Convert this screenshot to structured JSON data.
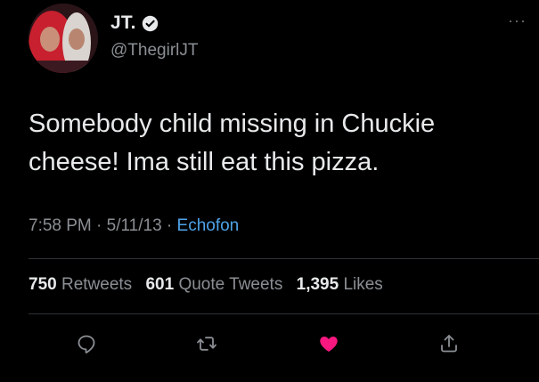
{
  "user": {
    "display_name": "JT.",
    "handle": "@ThegirlJT",
    "verified": true
  },
  "tweet": {
    "text_line1": "Somebody child missing in Chuckie",
    "text_line2": "cheese! Ima still eat this pizza.",
    "time": "7:58 PM",
    "sep1": " · ",
    "date": "5/11/13",
    "sep2": " · ",
    "source": "Echofon"
  },
  "stats": {
    "retweets_count": "750",
    "retweets_label": "Retweets",
    "quotes_count": "601",
    "quotes_label": "Quote Tweets",
    "likes_count": "1,395",
    "likes_label": "Likes"
  },
  "icons": {
    "more": "more-icon",
    "reply": "reply-icon",
    "retweet": "retweet-icon",
    "like": "heart-icon",
    "share": "share-icon",
    "verified": "verified-badge-icon"
  },
  "colors": {
    "background": "#000000",
    "text": "#e7e9ea",
    "muted": "#8b8f94",
    "link": "#4fa3e8",
    "like": "#f91880",
    "divider": "#2f3336"
  }
}
